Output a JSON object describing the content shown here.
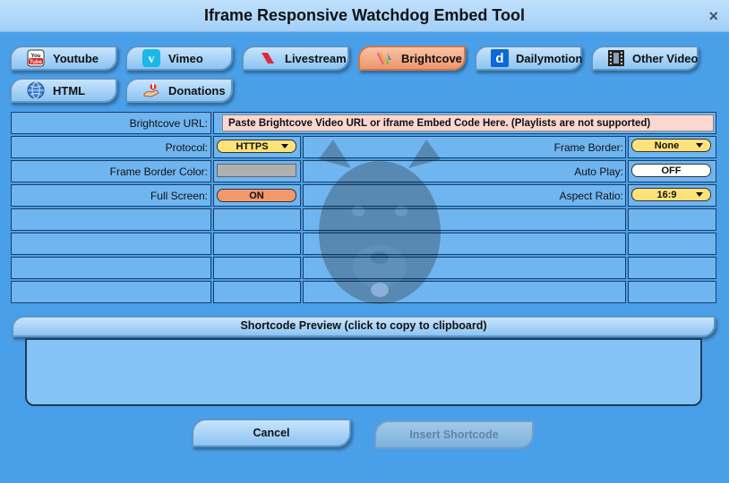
{
  "window": {
    "title": "Iframe Responsive Watchdog Embed Tool",
    "close_glyph": "×"
  },
  "tabs": [
    {
      "label": "Youtube",
      "icon": "youtube-icon",
      "active": false
    },
    {
      "label": "Vimeo",
      "icon": "vimeo-icon",
      "active": false
    },
    {
      "label": "Livestream",
      "icon": "livestream-icon",
      "active": false
    },
    {
      "label": "Brightcove",
      "icon": "brightcove-icon",
      "active": true
    },
    {
      "label": "Dailymotion",
      "icon": "dailymotion-icon",
      "active": false
    },
    {
      "label": "Other Video",
      "icon": "film-icon",
      "active": false
    },
    {
      "label": "HTML",
      "icon": "globe-icon",
      "active": false
    },
    {
      "label": "Donations",
      "icon": "donations-icon",
      "active": false
    }
  ],
  "form": {
    "url_label": "Brightcove URL:",
    "url_placeholder": "Paste Brightcove Video URL or iframe Embed Code Here. (Playlists are not supported)",
    "protocol_label": "Protocol:",
    "protocol_value": "HTTPS",
    "frame_border_label": "Frame Border:",
    "frame_border_value": "None",
    "border_color_label": "Frame Border Color:",
    "border_color_value": "#b0b0b0",
    "autoplay_label": "Auto Play:",
    "autoplay_value": "OFF",
    "fullscreen_label": "Full Screen:",
    "fullscreen_value": "ON",
    "aspect_label": "Aspect Ratio:",
    "aspect_value": "16:9"
  },
  "preview": {
    "title": "Shortcode Preview (click to copy to clipboard)",
    "content": ""
  },
  "buttons": {
    "cancel": "Cancel",
    "insert": "Insert Shortcode"
  },
  "colors": {
    "background": "#4a9fe9",
    "tab_active": "#ee956a",
    "tab_inactive": "#a6d3f7",
    "select_yellow": "#fde27a",
    "toggle_on": "#f3976d",
    "url_field": "#fcd7cf"
  }
}
